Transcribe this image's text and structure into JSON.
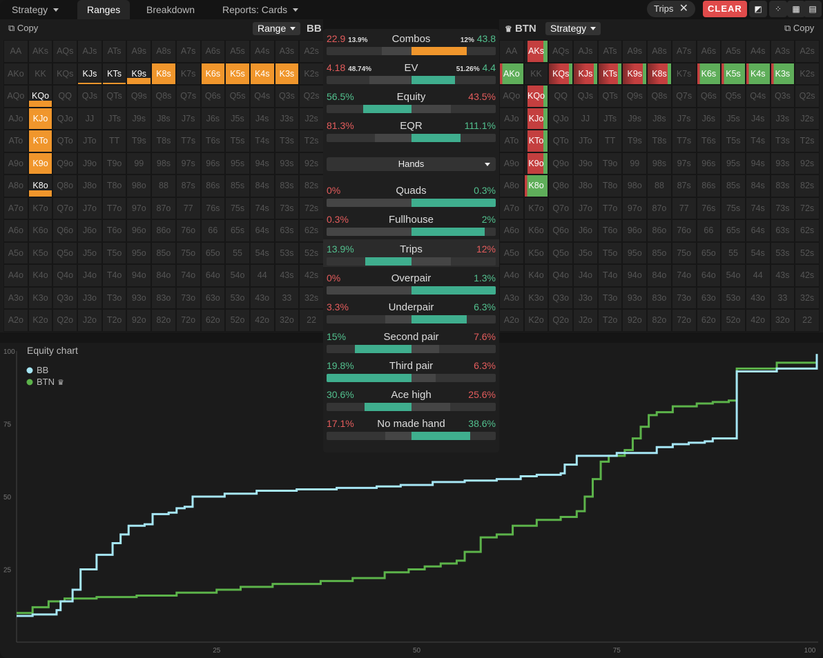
{
  "tabs": [
    {
      "label": "Strategy"
    },
    {
      "label": "Ranges"
    },
    {
      "label": "Breakdown"
    },
    {
      "label": "Reports: Cards"
    }
  ],
  "filter": {
    "label": "Trips"
  },
  "clear_label": "CLEAR",
  "left": {
    "copy": "Copy",
    "dropdown": "Range",
    "player": "BB"
  },
  "right": {
    "copy": "Copy",
    "dropdown": "Strategy",
    "player": "BTN"
  },
  "hands": [
    "AA",
    "AKs",
    "AQs",
    "AJs",
    "ATs",
    "A9s",
    "A8s",
    "A7s",
    "A6s",
    "A5s",
    "A4s",
    "A3s",
    "A2s",
    "AKo",
    "KK",
    "KQs",
    "KJs",
    "KTs",
    "K9s",
    "K8s",
    "K7s",
    "K6s",
    "K5s",
    "K4s",
    "K3s",
    "K2s",
    "AQo",
    "KQo",
    "QQ",
    "QJs",
    "QTs",
    "Q9s",
    "Q8s",
    "Q7s",
    "Q6s",
    "Q5s",
    "Q4s",
    "Q3s",
    "Q2s",
    "AJo",
    "KJo",
    "QJo",
    "JJ",
    "JTs",
    "J9s",
    "J8s",
    "J7s",
    "J6s",
    "J5s",
    "J4s",
    "J3s",
    "J2s",
    "ATo",
    "KTo",
    "QTo",
    "JTo",
    "TT",
    "T9s",
    "T8s",
    "T7s",
    "T6s",
    "T5s",
    "T4s",
    "T3s",
    "T2s",
    "A9o",
    "K9o",
    "Q9o",
    "J9o",
    "T9o",
    "99",
    "98s",
    "97s",
    "96s",
    "95s",
    "94s",
    "93s",
    "92s",
    "A8o",
    "K8o",
    "Q8o",
    "J8o",
    "T8o",
    "98o",
    "88",
    "87s",
    "86s",
    "85s",
    "84s",
    "83s",
    "82s",
    "A7o",
    "K7o",
    "Q7o",
    "J7o",
    "T7o",
    "97o",
    "87o",
    "77",
    "76s",
    "75s",
    "74s",
    "73s",
    "72s",
    "A6o",
    "K6o",
    "Q6o",
    "J6o",
    "T6o",
    "96o",
    "86o",
    "76o",
    "66",
    "65s",
    "64s",
    "63s",
    "62s",
    "A5o",
    "K5o",
    "Q5o",
    "J5o",
    "T5o",
    "95o",
    "85o",
    "75o",
    "65o",
    "55",
    "54s",
    "53s",
    "52s",
    "A4o",
    "K4o",
    "Q4o",
    "J4o",
    "T4o",
    "94o",
    "84o",
    "74o",
    "64o",
    "54o",
    "44",
    "43s",
    "42s",
    "A3o",
    "K3o",
    "Q3o",
    "J3o",
    "T3o",
    "93o",
    "83o",
    "73o",
    "63o",
    "53o",
    "43o",
    "33",
    "32s",
    "A2o",
    "K2o",
    "Q2o",
    "J2o",
    "T2o",
    "92o",
    "82o",
    "72o",
    "62o",
    "52o",
    "42o",
    "32o",
    "22"
  ],
  "stats": {
    "combos": {
      "label": "Combos",
      "left": "22.9",
      "left_pct": "13.9%",
      "right_pct": "12%",
      "right": "43.8"
    },
    "ev": {
      "label": "EV",
      "left": "4.18",
      "left_pct": "48.74%",
      "right_pct": "51.26%",
      "right": "4.4"
    },
    "equity": {
      "label": "Equity",
      "left": "56.5%",
      "right": "43.5%"
    },
    "eqr": {
      "label": "EQR",
      "left": "81.3%",
      "right": "111.1%"
    },
    "hands_dropdown": "Hands",
    "rows": [
      {
        "label": "Quads",
        "left": "0%",
        "right": "0.3%"
      },
      {
        "label": "Fullhouse",
        "left": "0.3%",
        "right": "2%"
      },
      {
        "label": "Trips",
        "left": "13.9%",
        "right": "12%"
      },
      {
        "label": "Overpair",
        "left": "0%",
        "right": "1.3%"
      },
      {
        "label": "Underpair",
        "left": "3.3%",
        "right": "6.3%"
      },
      {
        "label": "Second pair",
        "left": "15%",
        "right": "7.6%"
      },
      {
        "label": "Third pair",
        "left": "19.8%",
        "right": "6.3%"
      },
      {
        "label": "Ace high",
        "left": "30.6%",
        "right": "25.6%"
      },
      {
        "label": "No made hand",
        "left": "17.1%",
        "right": "38.6%"
      }
    ]
  },
  "colors": {
    "bb": "#a6e6f5",
    "btn": "#5cb34a",
    "accent_orange": "#f0962c",
    "red": "#e45c5c",
    "green": "#52c08e"
  },
  "chart_data": {
    "type": "line",
    "title": "Equity chart",
    "xlim": [
      0,
      100
    ],
    "ylim": [
      0,
      100
    ],
    "x_ticks": [
      "25",
      "50",
      "75",
      "100"
    ],
    "y_ticks": [
      "100",
      "75",
      "50",
      "25"
    ],
    "legend": "top-left",
    "series": [
      {
        "name": "BB",
        "color": "#a6e6f5",
        "points": [
          [
            0,
            9
          ],
          [
            2,
            9.5
          ],
          [
            5,
            11
          ],
          [
            5.5,
            14
          ],
          [
            7,
            18
          ],
          [
            8,
            25
          ],
          [
            10,
            30
          ],
          [
            12,
            34
          ],
          [
            13,
            37
          ],
          [
            14,
            40
          ],
          [
            16,
            40.5
          ],
          [
            17,
            44
          ],
          [
            19,
            44.5
          ],
          [
            20,
            46
          ],
          [
            21,
            46.5
          ],
          [
            22,
            50
          ],
          [
            26,
            51
          ],
          [
            30,
            52
          ],
          [
            35,
            52.5
          ],
          [
            40,
            53
          ],
          [
            45,
            53.5
          ],
          [
            48,
            54
          ],
          [
            50,
            54
          ],
          [
            52,
            55
          ],
          [
            56,
            55.5
          ],
          [
            60,
            56
          ],
          [
            63,
            57
          ],
          [
            65,
            57.5
          ],
          [
            68,
            58
          ],
          [
            68.5,
            61
          ],
          [
            70,
            64
          ],
          [
            75,
            65
          ],
          [
            80,
            67
          ],
          [
            82,
            68
          ],
          [
            84,
            68.5
          ],
          [
            86,
            69
          ],
          [
            87,
            70
          ],
          [
            89,
            70
          ],
          [
            90,
            93
          ],
          [
            95,
            94
          ],
          [
            100,
            99
          ]
        ]
      },
      {
        "name": "BTN",
        "color": "#5cb34a",
        "points": [
          [
            0,
            10
          ],
          [
            2,
            12
          ],
          [
            4,
            14
          ],
          [
            6,
            15
          ],
          [
            10,
            15.5
          ],
          [
            15,
            16
          ],
          [
            20,
            17
          ],
          [
            25,
            18
          ],
          [
            28,
            19
          ],
          [
            32,
            20
          ],
          [
            38,
            21
          ],
          [
            42,
            22
          ],
          [
            46,
            24
          ],
          [
            49,
            25
          ],
          [
            51,
            26
          ],
          [
            53,
            27
          ],
          [
            55,
            28
          ],
          [
            56,
            31
          ],
          [
            58,
            36
          ],
          [
            60,
            37
          ],
          [
            62,
            40
          ],
          [
            65,
            42
          ],
          [
            68,
            43
          ],
          [
            70,
            45
          ],
          [
            71,
            50
          ],
          [
            72,
            56
          ],
          [
            73,
            62
          ],
          [
            74,
            64
          ],
          [
            76,
            66
          ],
          [
            77,
            70
          ],
          [
            78,
            74
          ],
          [
            79,
            78
          ],
          [
            80,
            79
          ],
          [
            82,
            81
          ],
          [
            85,
            82
          ],
          [
            87,
            82.5
          ],
          [
            89,
            83
          ],
          [
            90,
            94
          ],
          [
            95,
            96
          ],
          [
            100,
            99
          ]
        ]
      }
    ]
  }
}
